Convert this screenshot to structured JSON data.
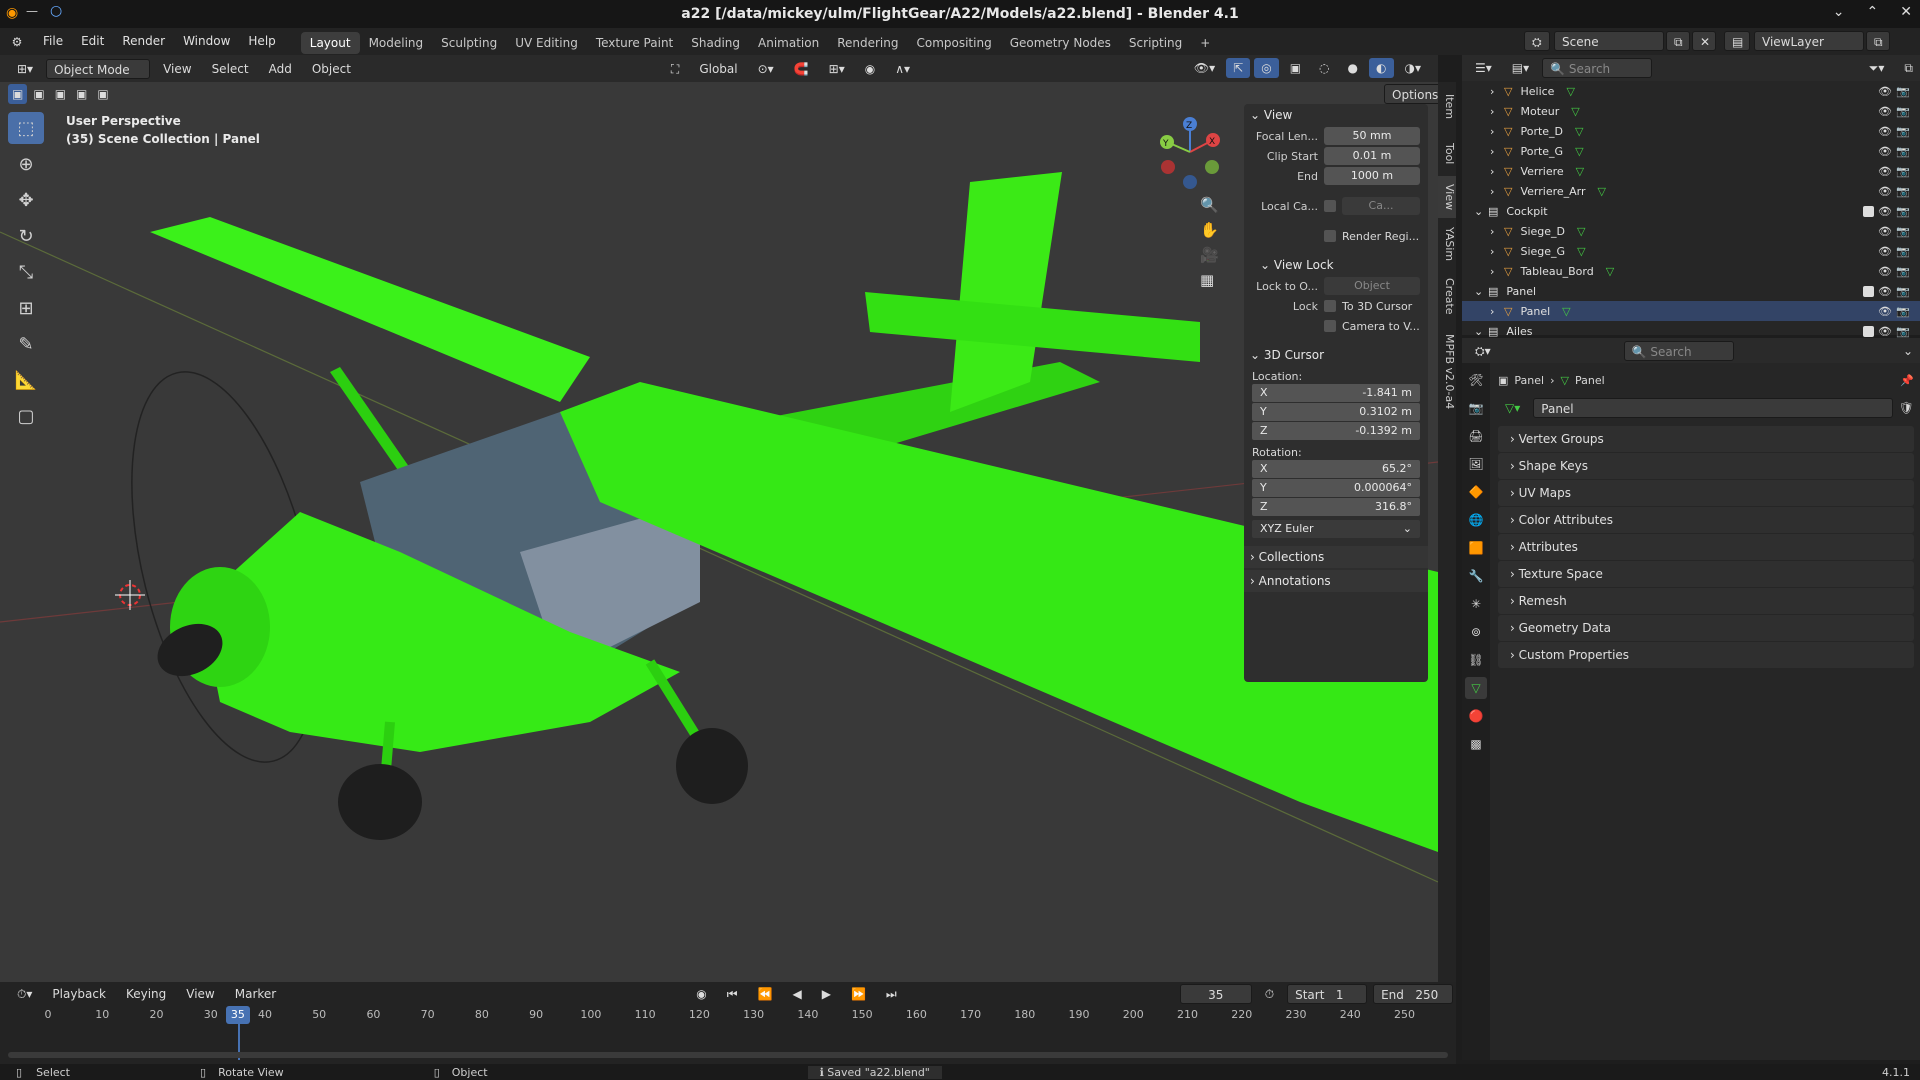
{
  "window": {
    "title": "a22 [/data/mickey/ulm/FlightGear/A22/Models/a22.blend] - Blender 4.1",
    "controls": [
      "⌄",
      "⌃",
      "✕"
    ]
  },
  "menu": {
    "items": [
      "File",
      "Edit",
      "Render",
      "Window",
      "Help"
    ],
    "workspaces": [
      "Layout",
      "Modeling",
      "Sculpting",
      "UV Editing",
      "Texture Paint",
      "Shading",
      "Animation",
      "Rendering",
      "Compositing",
      "Geometry Nodes",
      "Scripting"
    ],
    "add_tab": "+",
    "scene_label": "Scene",
    "viewlayer_label": "ViewLayer"
  },
  "viewport_header": {
    "mode": "Object Mode",
    "menus": [
      "View",
      "Select",
      "Add",
      "Object"
    ],
    "transform": "Global",
    "options": "Options"
  },
  "viewport": {
    "perspective": "User Perspective",
    "collection_info": "(35) Scene Collection | Panel",
    "gizmo": {
      "x": "X",
      "y": "Y",
      "z": "Z"
    }
  },
  "npanel": {
    "view_section": "View",
    "focal_label": "Focal Len...",
    "focal_value": "50 mm",
    "clip_start_label": "Clip Start",
    "clip_start_value": "0.01 m",
    "clip_end_label": "End",
    "clip_end_value": "1000 m",
    "local_cam_label": "Local Ca...",
    "local_cam_value": "Ca...",
    "render_region": "Render Regi...",
    "view_lock_section": "View Lock",
    "lock_to_label": "Lock to O...",
    "lock_to_value": "Object",
    "lock_label": "Lock",
    "to_cursor": "To 3D Cursor",
    "camera_to_view": "Camera to V...",
    "cursor_section": "3D Cursor",
    "location_label": "Location:",
    "loc_x": "-1.841 m",
    "loc_y": "0.3102 m",
    "loc_z": "-0.1392 m",
    "rotation_label": "Rotation:",
    "rot_x": "65.2°",
    "rot_y": "0.000064°",
    "rot_z": "316.8°",
    "rot_mode": "XYZ Euler",
    "collections": "Collections",
    "annotations": "Annotations",
    "axis_x": "X",
    "axis_y": "Y",
    "axis_z": "Z"
  },
  "side_tabs": [
    "Item",
    "Tool",
    "View",
    "YASim",
    "Create",
    "MPFB v2.0-a4"
  ],
  "outliner": {
    "search_placeholder": "Search",
    "rows": [
      {
        "label": "Helice",
        "indent": 1,
        "type": "object",
        "data": true
      },
      {
        "label": "Moteur",
        "indent": 1,
        "type": "object",
        "data": true
      },
      {
        "label": "Porte_D",
        "indent": 1,
        "type": "object",
        "data": true
      },
      {
        "label": "Porte_G",
        "indent": 1,
        "type": "object",
        "data": true
      },
      {
        "label": "Verriere",
        "indent": 1,
        "type": "object",
        "data": true
      },
      {
        "label": "Verriere_Arr",
        "indent": 1,
        "type": "object",
        "data": true
      },
      {
        "label": "Cockpit",
        "indent": 0,
        "type": "collection",
        "data": false
      },
      {
        "label": "Siege_D",
        "indent": 1,
        "type": "object",
        "data": true
      },
      {
        "label": "Siege_G",
        "indent": 1,
        "type": "object",
        "data": true
      },
      {
        "label": "Tableau_Bord",
        "indent": 1,
        "type": "object",
        "data": true
      },
      {
        "label": "Panel",
        "indent": 0,
        "type": "collection",
        "data": false
      },
      {
        "label": "Panel",
        "indent": 1,
        "type": "object",
        "data": true
      },
      {
        "label": "Ailes",
        "indent": 0,
        "type": "collection",
        "data": false
      }
    ]
  },
  "properties": {
    "search_placeholder": "Search",
    "breadcrumb_object": "Panel",
    "breadcrumb_data": "Panel",
    "datablock_name": "Panel",
    "sections": [
      "Vertex Groups",
      "Shape Keys",
      "UV Maps",
      "Color Attributes",
      "Attributes",
      "Texture Space",
      "Remesh",
      "Geometry Data",
      "Custom Properties"
    ]
  },
  "timeline": {
    "menus": [
      "Playback",
      "Keying",
      "View",
      "Marker"
    ],
    "current_frame": "35",
    "start_label": "Start",
    "start_value": "1",
    "end_label": "End",
    "end_value": "250",
    "ticks": [
      "0",
      "10",
      "20",
      "30",
      "40",
      "50",
      "60",
      "70",
      "80",
      "90",
      "100",
      "110",
      "120",
      "130",
      "140",
      "150",
      "160",
      "170",
      "180",
      "190",
      "200",
      "210",
      "220",
      "230",
      "240",
      "250"
    ]
  },
  "statusbar": {
    "select": "Select",
    "rotate": "Rotate View",
    "object": "Object",
    "message": "Saved \"a22.blend\"",
    "version": "4.1.1"
  },
  "colors": {
    "plane_green": "#33ee11",
    "accent_blue": "#4772b3",
    "x_axis": "#d44",
    "y_axis": "#8c4"
  }
}
